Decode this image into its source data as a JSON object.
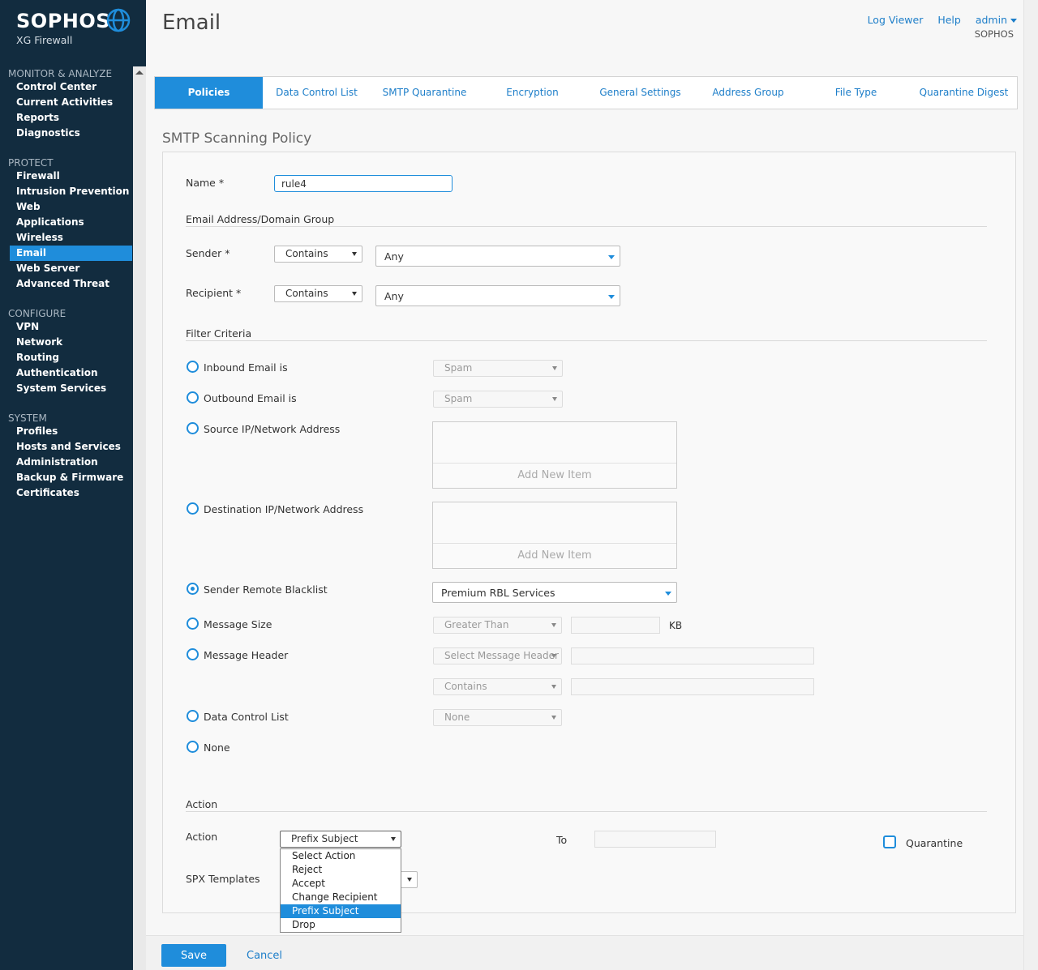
{
  "app": {
    "brand": "SOPHOS",
    "product": "XG Firewall"
  },
  "header": {
    "title": "Email",
    "links": {
      "log_viewer": "Log Viewer",
      "help": "Help",
      "admin": "admin"
    },
    "tenant": "SOPHOS"
  },
  "sidebar": {
    "sections": [
      {
        "title": "MONITOR & ANALYZE",
        "items": [
          "Control Center",
          "Current Activities",
          "Reports",
          "Diagnostics"
        ]
      },
      {
        "title": "PROTECT",
        "items": [
          "Firewall",
          "Intrusion Prevention",
          "Web",
          "Applications",
          "Wireless",
          "Email",
          "Web Server",
          "Advanced Threat"
        ]
      },
      {
        "title": "CONFIGURE",
        "items": [
          "VPN",
          "Network",
          "Routing",
          "Authentication",
          "System Services"
        ]
      },
      {
        "title": "SYSTEM",
        "items": [
          "Profiles",
          "Hosts and Services",
          "Administration",
          "Backup & Firmware",
          "Certificates"
        ]
      }
    ],
    "active": "Email"
  },
  "tabs": [
    "Policies",
    "Data Control List",
    "SMTP Quarantine",
    "Encryption",
    "General Settings",
    "Address Group",
    "File Type",
    "Quarantine Digest"
  ],
  "active_tab": "Policies",
  "form": {
    "section_title": "SMTP Scanning Policy",
    "name_label": "Name *",
    "name_value": "rule4",
    "email_group_title": "Email Address/Domain Group",
    "sender_label": "Sender *",
    "sender_op": "Contains",
    "sender_value": "Any",
    "recipient_label": "Recipient *",
    "recipient_op": "Contains",
    "recipient_value": "Any",
    "filter_title": "Filter Criteria",
    "inbound_label": "Inbound Email is",
    "inbound_value": "Spam",
    "outbound_label": "Outbound Email is",
    "outbound_value": "Spam",
    "source_label": "Source IP/Network Address",
    "dest_label": "Destination IP/Network Address",
    "add_new_item": "Add New Item",
    "rbl_label": "Sender Remote Blacklist",
    "rbl_value": "Premium RBL Services",
    "size_label": "Message Size",
    "size_op": "Greater Than",
    "size_unit": "KB",
    "header_label": "Message Header",
    "header_select": "Select Message Header",
    "header_op": "Contains",
    "dcl_label": "Data Control List",
    "dcl_value": "None",
    "none_label": "None",
    "action_title": "Action",
    "action_label": "Action",
    "action_value": "Prefix Subject",
    "to_label": "To",
    "quarantine_label": "Quarantine",
    "spx_label": "SPX Templates",
    "action_options": [
      "Select Action",
      "Reject",
      "Accept",
      "Change Recipient",
      "Prefix Subject",
      "Drop"
    ],
    "selected_option": "Prefix Subject"
  },
  "buttons": {
    "save": "Save",
    "cancel": "Cancel"
  }
}
